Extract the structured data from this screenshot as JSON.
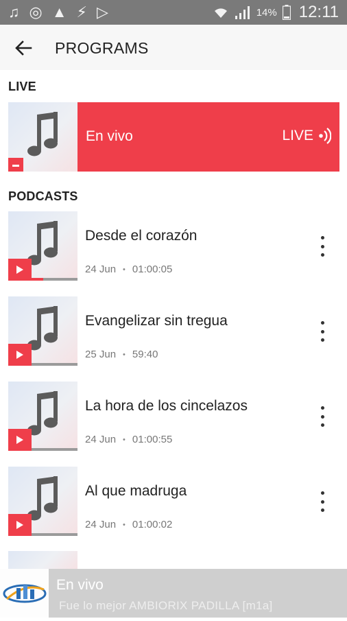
{
  "status_bar": {
    "battery_percent": "14%",
    "time": "12:11",
    "icons": [
      "music-note-icon",
      "sync-icon",
      "warning-icon",
      "flash-icon",
      "play-store-icon",
      "wifi-icon",
      "signal-icon",
      "battery-icon"
    ]
  },
  "appbar": {
    "title": "PROGRAMS",
    "back_icon": "arrow-back-icon"
  },
  "live_section": {
    "label": "LIVE",
    "item": {
      "title": "En vivo",
      "badge": "LIVE",
      "badge_icon": "broadcast-icon"
    }
  },
  "podcasts_section": {
    "label": "PODCASTS",
    "items": [
      {
        "title": "Desde el corazón",
        "date": "24 Jun",
        "duration": "01:00:05",
        "progress": 0.5
      },
      {
        "title": "Evangelizar sin tregua",
        "date": "25 Jun",
        "duration": "59:40",
        "progress": 0
      },
      {
        "title": "La hora de los cincelazos",
        "date": "24 Jun",
        "duration": "01:00:55",
        "progress": 0
      },
      {
        "title": "Al que madruga",
        "date": "24 Jun",
        "duration": "01:00:02",
        "progress": 0
      }
    ]
  },
  "player": {
    "title": "En vivo",
    "subtitle": "Fue lo mejor AMBIORIX PADILLA [m1a]"
  },
  "colors": {
    "accent": "#ef3e4a",
    "statusbar": "#7a7a7a",
    "player_bg": "#cfcfcf"
  }
}
